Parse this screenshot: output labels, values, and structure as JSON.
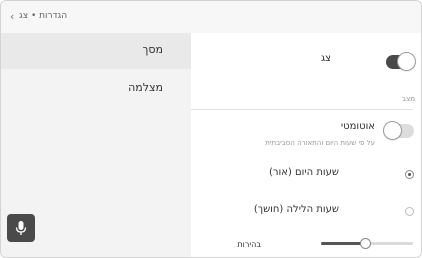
{
  "header": {
    "breadcrumb_parent": "הגדרות",
    "breadcrumb_current": "צג",
    "breadcrumb_separator": "•",
    "back_icon": "chevron-left-icon"
  },
  "sidebar": {
    "items": [
      {
        "label": "מסך",
        "selected": true
      },
      {
        "label": "מצלמה",
        "selected": false
      }
    ],
    "mic_icon": "microphone-icon"
  },
  "main": {
    "display_toggle": {
      "label": "צג",
      "on": true
    },
    "section_label": "מצב",
    "auto_toggle": {
      "label": "אוטומטי",
      "subtitle": "על פי שעות היום והתאורה הסביבתית",
      "on": false
    },
    "options": [
      {
        "label": "שעות היום (אור)",
        "checked": true
      },
      {
        "label": "שעות הלילה (חושך)",
        "checked": false
      }
    ],
    "brightness": {
      "label": "בהירות",
      "value_fraction": 0.48
    }
  },
  "colors": {
    "accent": "#4a4a4a",
    "selected_bg": "#e9e9e9"
  }
}
